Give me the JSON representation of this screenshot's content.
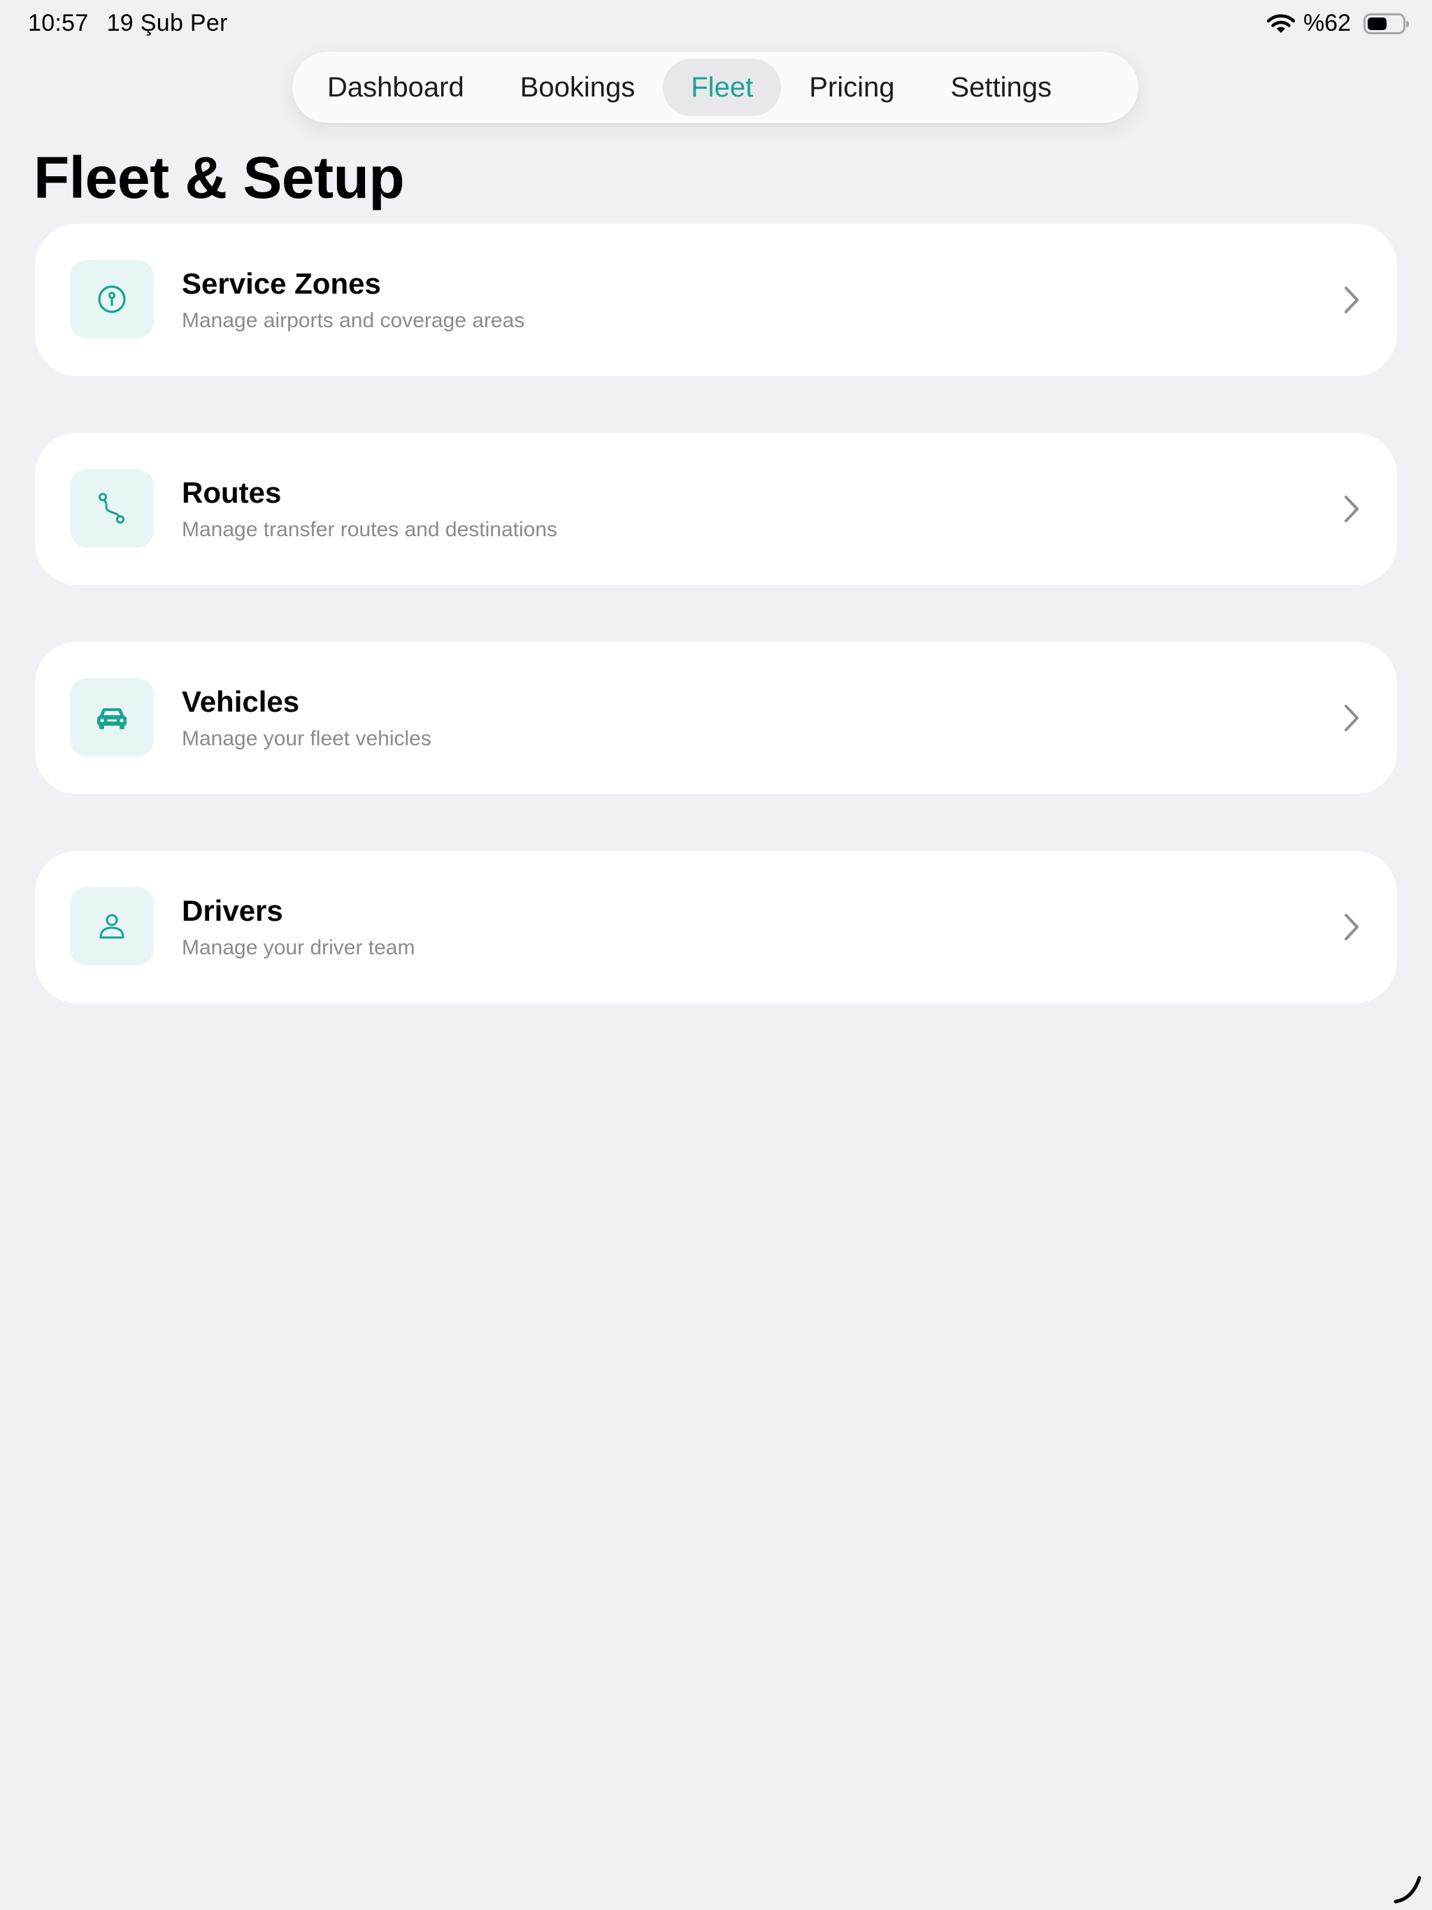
{
  "status_bar": {
    "time": "10:57",
    "date": "19 Şub Per",
    "battery_text": "%62",
    "battery_level_percent": 62
  },
  "tabs": [
    {
      "label": "Dashboard",
      "active": false
    },
    {
      "label": "Bookings",
      "active": false
    },
    {
      "label": "Fleet",
      "active": true
    },
    {
      "label": "Pricing",
      "active": false
    },
    {
      "label": "Settings",
      "active": false
    }
  ],
  "page": {
    "title": "Fleet & Setup"
  },
  "cards": [
    {
      "icon": "pin-icon",
      "title": "Service Zones",
      "subtitle": "Manage airports and coverage areas"
    },
    {
      "icon": "route-icon",
      "title": "Routes",
      "subtitle": "Manage transfer routes and destinations"
    },
    {
      "icon": "car-icon",
      "title": "Vehicles",
      "subtitle": "Manage your fleet vehicles"
    },
    {
      "icon": "person-icon",
      "title": "Drivers",
      "subtitle": "Manage your driver team"
    }
  ],
  "colors": {
    "accent": "#1aa391",
    "background": "#f0f0f5",
    "card": "#ffffff",
    "icon_tile": "#e7f6f4",
    "secondary_text": "#8a8a8f"
  }
}
